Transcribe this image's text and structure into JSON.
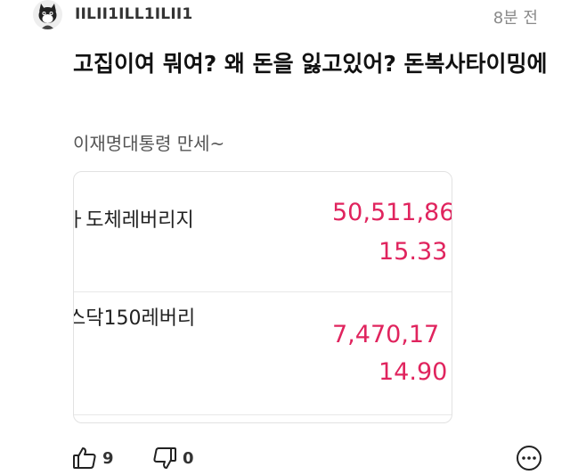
{
  "comment": {
    "author": "IILII1ILL1ILII1",
    "time": "8분 전",
    "title": "고집이여 뭐여? 왜 돈을 잃고있어? 돈복사타이밍에",
    "body": "이재명대통령 만세~",
    "attachment": {
      "rows": [
        {
          "name": "ㅏ도체레버리지",
          "value": "50,511,86",
          "rate": "15.33"
        },
        {
          "name": "스닥150레버리",
          "value": "7,470,17",
          "rate": "14.90"
        }
      ],
      "value_color": "#e0245e"
    },
    "actions": {
      "like_count": "9",
      "dislike_count": "0",
      "like_icon": "thumbs-up-icon",
      "dislike_icon": "thumbs-down-icon",
      "more_icon": "more-options-icon"
    }
  }
}
